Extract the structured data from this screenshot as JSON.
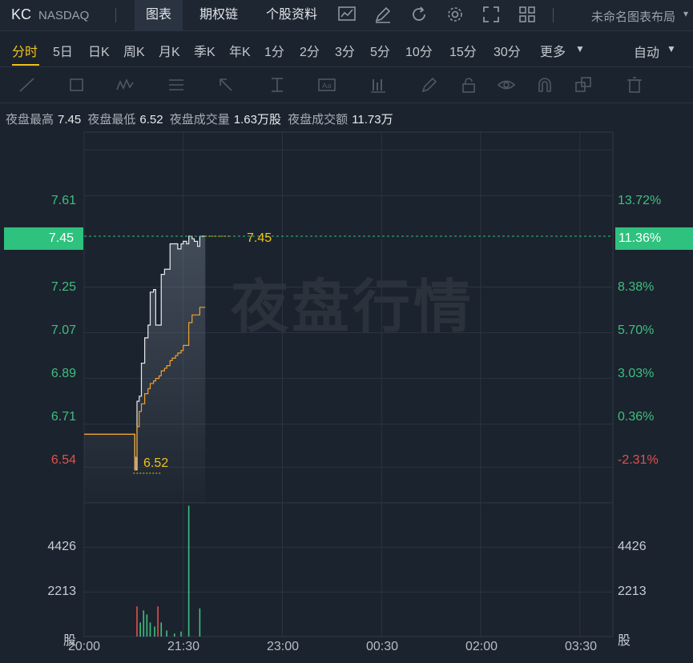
{
  "header": {
    "ticker": "KC",
    "exchange": "NASDAQ",
    "tabs": [
      {
        "label": "图表",
        "active": true
      },
      {
        "label": "期权链",
        "active": false
      },
      {
        "label": "个股资料",
        "active": false
      }
    ],
    "icons": [
      "chart-line-icon",
      "edit-pen-icon",
      "refresh-icon",
      "gear-icon",
      "fullscreen-icon",
      "grid-layout-icon"
    ],
    "layout_label": "未命名图表布局"
  },
  "periods": {
    "items": [
      "分时",
      "5日",
      "日K",
      "周K",
      "月K",
      "季K",
      "年K",
      "1分",
      "2分",
      "3分",
      "5分",
      "10分",
      "15分",
      "30分",
      "更多"
    ],
    "active": "分时",
    "auto_label": "自动"
  },
  "drawing_tools": [
    "line-tool-icon",
    "rect-tool-icon",
    "wave-tool-icon",
    "fib-tool-icon",
    "arrow-tool-icon",
    "measure-tool-icon",
    "text-tool-icon",
    "note-tool-icon",
    "brush-icon",
    "lock-icon",
    "eye-icon",
    "magnet-icon",
    "clone-icon",
    "trash-icon"
  ],
  "stats": {
    "high_label": "夜盘最高",
    "high_value": "7.45",
    "low_label": "夜盘最低",
    "low_value": "6.52",
    "volume_label": "夜盘成交量",
    "volume_value": "1.63万股",
    "amount_label": "夜盘成交额",
    "amount_value": "11.73万"
  },
  "colors": {
    "up": "#3fbf7f",
    "down": "#e0524d",
    "price_line": "#e8ebef",
    "avg_line": "#f0a030",
    "marker": "#f0c419",
    "background": "#1b232e"
  },
  "chart_data": {
    "type": "line",
    "x_ticks": [
      "20:00",
      "21:30",
      "23:00",
      "00:30",
      "02:00",
      "03:30"
    ],
    "y_price_ticks": [
      "7.61",
      "7.25",
      "7.07",
      "6.89",
      "6.71",
      "6.54"
    ],
    "y_percent_ticks": [
      "13.72%",
      "8.38%",
      "5.70%",
      "3.03%",
      "0.36%",
      "-2.31%"
    ],
    "y_volume_ticks": [
      "4426",
      "2213"
    ],
    "volume_unit": "股",
    "ylim": [
      6.4,
      7.86
    ],
    "volume_max": 6639,
    "current_price": "7.45",
    "current_percent": "11.36%",
    "low_marker": "6.52",
    "high_marker": "7.45",
    "watermark": "夜盘行情",
    "series": [
      {
        "x": [
          "20:00",
          "20:45",
          "20:46",
          "20:47",
          "20:48",
          "20:50",
          "20:52",
          "20:55",
          "20:58",
          "21:00",
          "21:03",
          "21:05",
          "21:08",
          "21:10",
          "21:13",
          "21:15",
          "21:18",
          "21:20",
          "21:23",
          "21:25",
          "21:28",
          "21:30",
          "21:33",
          "21:35",
          "21:38",
          "21:40",
          "21:43",
          "21:45",
          "21:48",
          "21:50"
        ],
        "values": [
          6.67,
          6.67,
          6.53,
          6.53,
          6.8,
          6.82,
          6.95,
          7.05,
          7.1,
          7.23,
          7.24,
          7.1,
          7.1,
          7.3,
          7.32,
          7.32,
          7.42,
          7.42,
          7.42,
          7.4,
          7.42,
          7.43,
          7.42,
          7.45,
          7.44,
          7.43,
          7.41,
          7.45,
          7.45,
          7.45
        ]
      },
      {
        "x": [
          "20:00",
          "20:45",
          "20:46",
          "20:47",
          "20:48",
          "20:50",
          "20:52",
          "20:55",
          "20:58",
          "21:00",
          "21:03",
          "21:05",
          "21:08",
          "21:10",
          "21:13",
          "21:15",
          "21:18",
          "21:20",
          "21:23",
          "21:25",
          "21:28",
          "21:30",
          "21:33",
          "21:35",
          "21:38",
          "21:40",
          "21:43",
          "21:45",
          "21:48",
          "21:50"
        ],
        "values": [
          6.67,
          6.67,
          6.53,
          6.58,
          6.7,
          6.76,
          6.79,
          6.83,
          6.85,
          6.87,
          6.88,
          6.89,
          6.9,
          6.92,
          6.93,
          6.94,
          6.96,
          6.97,
          6.98,
          6.99,
          7.0,
          7.02,
          7.02,
          7.11,
          7.14,
          7.14,
          7.14,
          7.17,
          7.17,
          7.17
        ]
      }
    ],
    "volume": {
      "x": [
        "20:48",
        "20:51",
        "20:54",
        "20:57",
        "21:00",
        "21:04",
        "21:07",
        "21:10",
        "21:15",
        "21:22",
        "21:28",
        "21:35",
        "21:45"
      ],
      "values": [
        1500,
        700,
        1300,
        1100,
        700,
        500,
        1500,
        700,
        300,
        150,
        250,
        6500,
        1400
      ],
      "direction": [
        "down",
        "up",
        "up",
        "up",
        "up",
        "up",
        "down",
        "up",
        "up",
        "up",
        "up",
        "up",
        "up"
      ]
    }
  }
}
